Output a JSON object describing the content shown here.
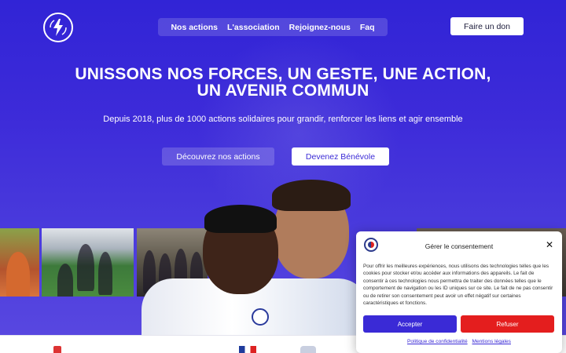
{
  "header": {
    "logo_name": "association-logo",
    "nav": [
      {
        "label": "Nos actions"
      },
      {
        "label": "L'association"
      },
      {
        "label": "Rejoignez-nous"
      },
      {
        "label": "Faq"
      }
    ],
    "donate_label": "Faire un don"
  },
  "hero": {
    "title_line1": "UNISSONS NOS FORCES, UN GESTE, UNE ACTION,",
    "title_line2": "UN AVENIR COMMUN",
    "subtitle": "Depuis 2018, plus de 1000 actions solidaires pour grandir, renforcer les liens et agir ensemble",
    "cta_primary": "Découvrez nos actions",
    "cta_secondary": "Devenez Bénévole"
  },
  "cookie_modal": {
    "title": "Gérer le consentement",
    "body": "Pour offrir les meilleures expériences, nous utilisons des technologies telles que les cookies pour stocker et/ou accéder aux informations des appareils. Le fait de consentir à ces technologies nous permettra de traiter des données telles que le comportement de navigation ou les ID uniques sur ce site. Le fait de ne pas consentir ou de retirer son consentement peut avoir un effet négatif sur certaines caractéristiques et fonctions.",
    "accept_label": "Accepter",
    "refuse_label": "Refuser",
    "links": [
      {
        "label": "Politique de confidentialité"
      },
      {
        "label": "Mentions légales"
      }
    ]
  },
  "colors": {
    "brand_primary": "#3a2ad6",
    "refuse": "#e41e1e"
  }
}
